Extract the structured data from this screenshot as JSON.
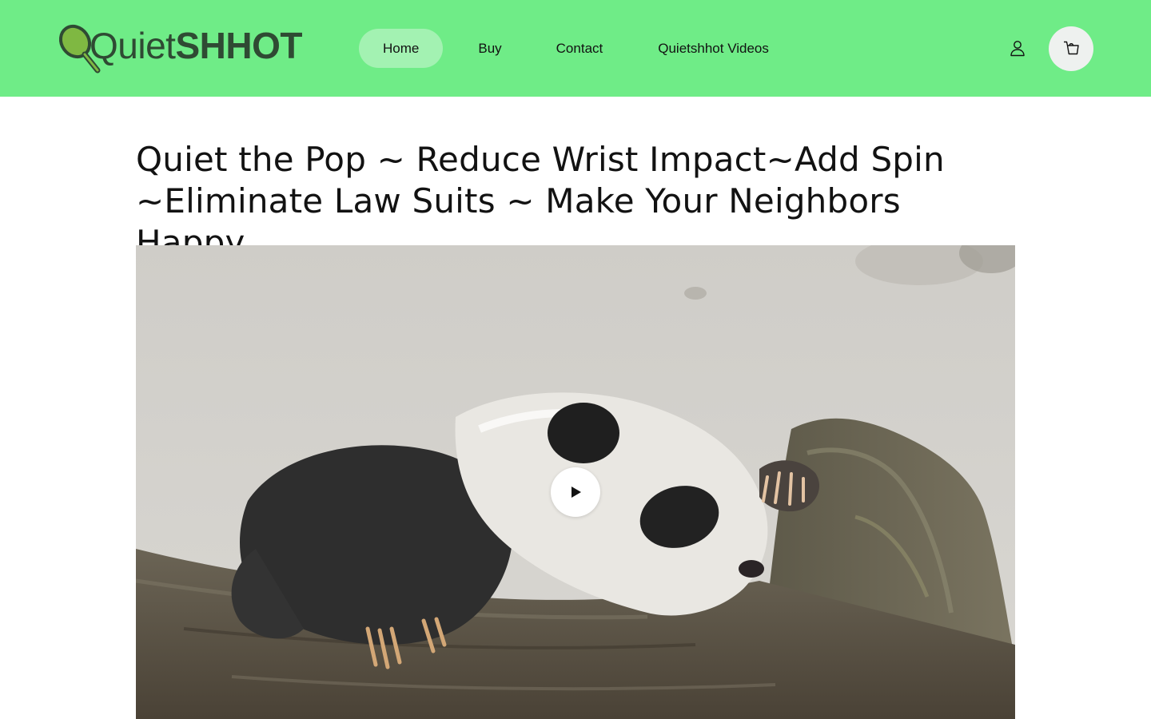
{
  "logo": {
    "text_part1": "Quiet",
    "text_part2": "SHHOT",
    "icon": "pickleball-paddle-icon"
  },
  "nav": {
    "items": [
      {
        "label": "Home",
        "active": true
      },
      {
        "label": "Buy",
        "active": false
      },
      {
        "label": "Contact",
        "active": false
      },
      {
        "label": "Quietshhot Videos",
        "active": false
      }
    ]
  },
  "header_icons": {
    "account": "user-icon",
    "cart": "cart-icon"
  },
  "main": {
    "title": "Quiet the Pop ~ Reduce Wrist Impact~Add Spin ~Eliminate Law Suits ~ Make Your Neighbors Happy",
    "video": {
      "subject": "panda cub sleeping on tree branch",
      "play_icon": "play-icon"
    }
  },
  "colors": {
    "header_bg": "#6fec87",
    "nav_active_bg": "#a3f2b2",
    "logo_text": "#2f4a33",
    "cart_bg": "#eef1ef",
    "text": "#121212"
  }
}
